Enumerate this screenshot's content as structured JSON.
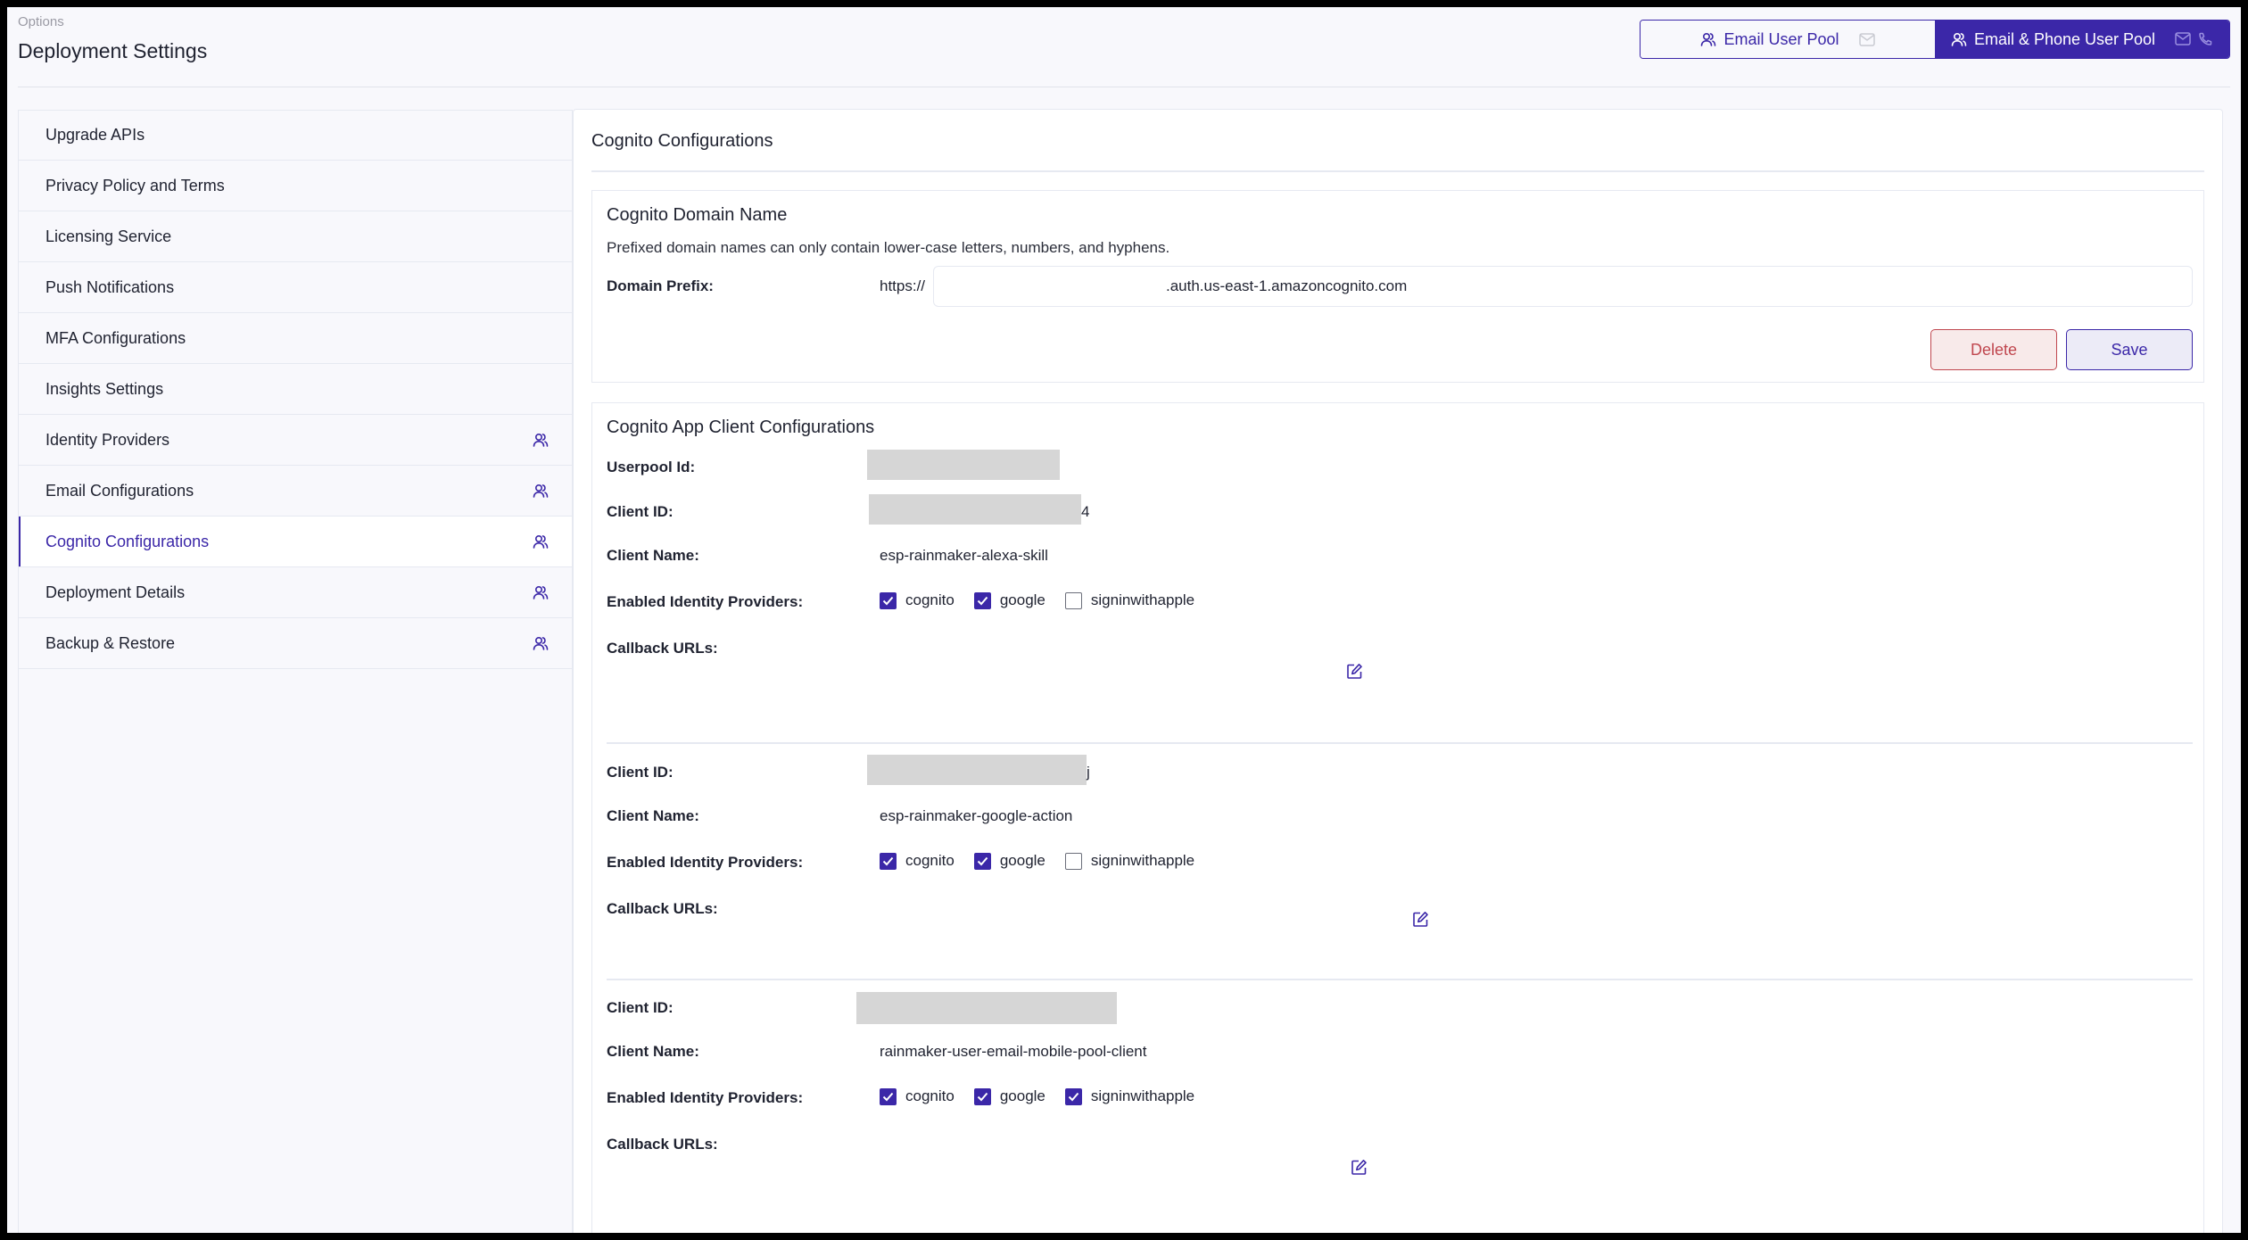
{
  "header": {
    "breadcrumb": "Options",
    "title": "Deployment Settings",
    "pool_toggle": [
      {
        "label": "Email User Pool",
        "active": false,
        "icons": [
          "users-icon",
          "mail-icon"
        ]
      },
      {
        "label": "Email & Phone User Pool",
        "active": true,
        "icons": [
          "users-icon",
          "mail-icon",
          "phone-icon"
        ]
      }
    ]
  },
  "sidebar": {
    "items": [
      {
        "label": "Upgrade APIs",
        "icon": null,
        "active": false
      },
      {
        "label": "Privacy Policy and Terms",
        "icon": null,
        "active": false
      },
      {
        "label": "Licensing Service",
        "icon": null,
        "active": false
      },
      {
        "label": "Push Notifications",
        "icon": null,
        "active": false
      },
      {
        "label": "MFA Configurations",
        "icon": null,
        "active": false
      },
      {
        "label": "Insights Settings",
        "icon": null,
        "active": false
      },
      {
        "label": "Identity Providers",
        "icon": "users-icon",
        "active": false
      },
      {
        "label": "Email Configurations",
        "icon": "users-icon",
        "active": false
      },
      {
        "label": "Cognito Configurations",
        "icon": "users-icon",
        "active": true
      },
      {
        "label": "Deployment Details",
        "icon": "users-icon",
        "active": false
      },
      {
        "label": "Backup & Restore",
        "icon": "users-icon",
        "active": false
      }
    ]
  },
  "main": {
    "title": "Cognito Configurations",
    "domain": {
      "title": "Cognito Domain Name",
      "description": "Prefixed domain names can only contain lower-case letters, numbers, and hyphens.",
      "prefix_label": "Domain Prefix:",
      "scheme": "https://",
      "input_value": ".auth.us-east-1.amazoncognito.com",
      "delete_label": "Delete",
      "save_label": "Save"
    },
    "clients": {
      "title": "Cognito App Client Configurations",
      "userpool_label": "Userpool Id:",
      "labels": {
        "client_id": "Client ID:",
        "client_name": "Client Name:",
        "providers": "Enabled Identity Providers:",
        "callbacks": "Callback URLs:"
      },
      "items": [
        {
          "client_id_visible_tail": "4",
          "client_name": "esp-rainmaker-alexa-skill",
          "providers": [
            {
              "name": "cognito",
              "checked": true
            },
            {
              "name": "google",
              "checked": true
            },
            {
              "name": "signinwithapple",
              "checked": false
            }
          ]
        },
        {
          "client_id_visible_tail": "j",
          "client_name": "esp-rainmaker-google-action",
          "providers": [
            {
              "name": "cognito",
              "checked": true
            },
            {
              "name": "google",
              "checked": true
            },
            {
              "name": "signinwithapple",
              "checked": false
            }
          ]
        },
        {
          "client_id_visible_tail": "",
          "client_name": "rainmaker-user-email-mobile-pool-client",
          "providers": [
            {
              "name": "cognito",
              "checked": true
            },
            {
              "name": "google",
              "checked": true
            },
            {
              "name": "signinwithapple",
              "checked": true
            }
          ]
        }
      ]
    }
  },
  "colors": {
    "accent": "#3b27a8",
    "danger": "#c0474f",
    "background": "#f8f8fc",
    "border": "#e6e9f1",
    "redaction": "#d6d6d6"
  }
}
